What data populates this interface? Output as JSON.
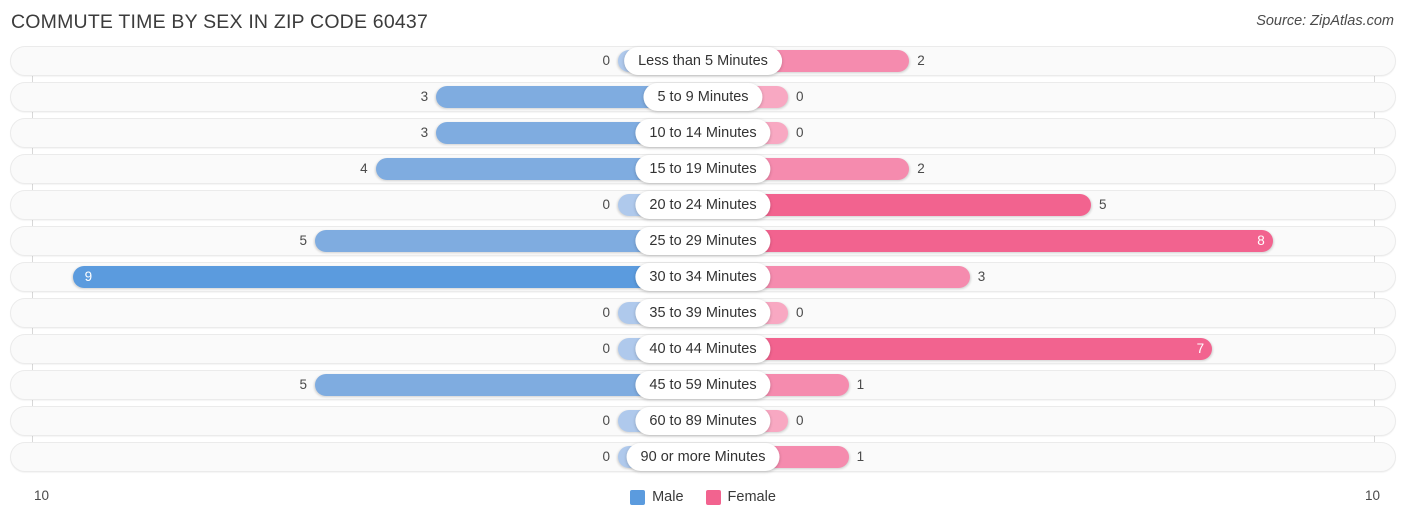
{
  "header": {
    "title": "COMMUTE TIME BY SEX IN ZIP CODE 60437",
    "source": "Source: ZipAtlas.com"
  },
  "axis": {
    "left_label": "10",
    "right_label": "10",
    "max": 10
  },
  "legend": {
    "items": [
      {
        "label": "Male",
        "color": "#5B9BDE"
      },
      {
        "label": "Female",
        "color": "#F2638F"
      }
    ]
  },
  "colors": {
    "male_light": "#AFC9EC",
    "male_mid": "#7FACE0",
    "male_dark": "#5B9BDE",
    "female_light": "#F8A8C2",
    "female_mid": "#F58BAE",
    "female_dark": "#F2638F",
    "track_bg": "#FAFAFA",
    "gridline": "#D8D8D8"
  },
  "chart_data": {
    "type": "bar",
    "title": "COMMUTE TIME BY SEX IN ZIP CODE 60437",
    "subtitle": "Source: ZipAtlas.com",
    "orientation": "horizontal-diverging",
    "xlabel": "",
    "ylabel": "",
    "xlim": [
      10,
      10
    ],
    "grid": true,
    "legend_position": "bottom-center",
    "categories": [
      "Less than 5 Minutes",
      "5 to 9 Minutes",
      "10 to 14 Minutes",
      "15 to 19 Minutes",
      "20 to 24 Minutes",
      "25 to 29 Minutes",
      "30 to 34 Minutes",
      "35 to 39 Minutes",
      "40 to 44 Minutes",
      "45 to 59 Minutes",
      "60 to 89 Minutes",
      "90 or more Minutes"
    ],
    "series": [
      {
        "name": "Male",
        "values": [
          0,
          3,
          3,
          4,
          0,
          5,
          9,
          0,
          0,
          5,
          0,
          0
        ]
      },
      {
        "name": "Female",
        "values": [
          2,
          0,
          0,
          2,
          5,
          8,
          3,
          0,
          7,
          1,
          0,
          1
        ]
      }
    ]
  },
  "rows": [
    {
      "category": "Less than 5 Minutes",
      "male": 0,
      "female": 2,
      "male_text": "0",
      "female_text": "2"
    },
    {
      "category": "5 to 9 Minutes",
      "male": 3,
      "female": 0,
      "male_text": "3",
      "female_text": "0"
    },
    {
      "category": "10 to 14 Minutes",
      "male": 3,
      "female": 0,
      "male_text": "3",
      "female_text": "0"
    },
    {
      "category": "15 to 19 Minutes",
      "male": 4,
      "female": 2,
      "male_text": "4",
      "female_text": "2"
    },
    {
      "category": "20 to 24 Minutes",
      "male": 0,
      "female": 5,
      "male_text": "0",
      "female_text": "5"
    },
    {
      "category": "25 to 29 Minutes",
      "male": 5,
      "female": 8,
      "male_text": "5",
      "female_text": "8"
    },
    {
      "category": "30 to 34 Minutes",
      "male": 9,
      "female": 3,
      "male_text": "9",
      "female_text": "3"
    },
    {
      "category": "35 to 39 Minutes",
      "male": 0,
      "female": 0,
      "male_text": "0",
      "female_text": "0"
    },
    {
      "category": "40 to 44 Minutes",
      "male": 0,
      "female": 7,
      "male_text": "0",
      "female_text": "7"
    },
    {
      "category": "45 to 59 Minutes",
      "male": 5,
      "female": 1,
      "male_text": "5",
      "female_text": "1"
    },
    {
      "category": "60 to 89 Minutes",
      "male": 0,
      "female": 0,
      "male_text": "0",
      "female_text": "0"
    },
    {
      "category": "90 or more Minutes",
      "male": 0,
      "female": 1,
      "male_text": "0",
      "female_text": "1"
    }
  ]
}
